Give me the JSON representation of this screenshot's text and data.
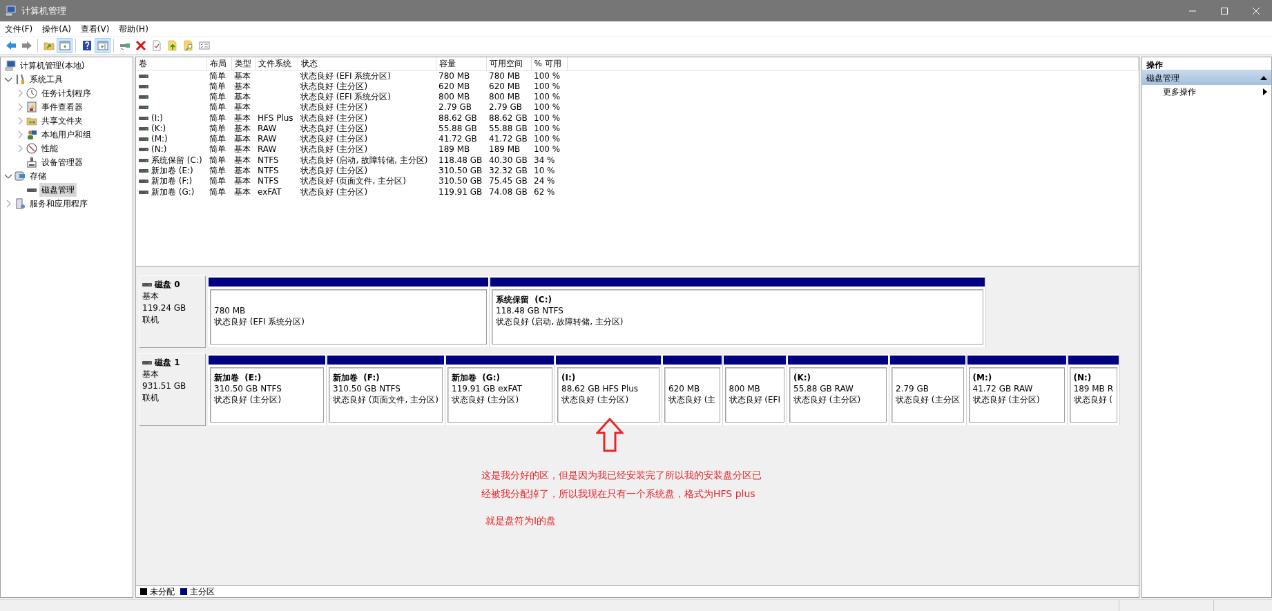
{
  "window": {
    "title": "计算机管理"
  },
  "menu": [
    {
      "label": "文件(F)"
    },
    {
      "label": "操作(A)"
    },
    {
      "label": "查看(V)"
    },
    {
      "label": "帮助(H)"
    }
  ],
  "toolbar": [
    {
      "kind": "button",
      "pressed": false
    },
    {
      "kind": "button",
      "pressed": false
    },
    {
      "kind": "separator"
    },
    {
      "kind": "button",
      "pressed": false
    },
    {
      "kind": "button",
      "pressed": true
    },
    {
      "kind": "separator"
    },
    {
      "kind": "button",
      "pressed": false
    },
    {
      "kind": "button",
      "pressed": true
    },
    {
      "kind": "separator"
    },
    {
      "kind": "button",
      "pressed": false
    },
    {
      "kind": "button",
      "pressed": false
    },
    {
      "kind": "button",
      "pressed": false
    },
    {
      "kind": "button",
      "pressed": false
    },
    {
      "kind": "button",
      "pressed": false
    },
    {
      "kind": "button",
      "pressed": false
    }
  ],
  "tree": [
    {
      "label": "计算机管理(本地)",
      "selected": false,
      "children": [
        {
          "label": "系统工具",
          "expanded": true,
          "selected": false,
          "children": [
            {
              "label": "任务计划程序",
              "expanded": false,
              "selected": false
            },
            {
              "label": "事件查看器",
              "expanded": false,
              "selected": false
            },
            {
              "label": "共享文件夹",
              "expanded": false,
              "selected": false
            },
            {
              "label": "本地用户和组",
              "expanded": false,
              "selected": false
            },
            {
              "label": "性能",
              "expanded": false,
              "selected": false
            },
            {
              "label": "设备管理器",
              "selected": false
            }
          ]
        },
        {
          "label": "存储",
          "expanded": true,
          "selected": false,
          "children": [
            {
              "label": "磁盘管理",
              "selected": true
            }
          ]
        },
        {
          "label": "服务和应用程序",
          "expanded": false,
          "selected": false
        }
      ]
    }
  ],
  "volumes": {
    "columns": [
      "卷",
      "布局",
      "类型",
      "文件系统",
      "状态",
      "容量",
      "可用空间",
      "% 可用"
    ],
    "rows": [
      {
        "layout": "简单",
        "type": "基本",
        "status": "状态良好 (EFI 系统分区)",
        "capacity": "780 MB",
        "free": "780 MB",
        "percent_free": "100 %"
      },
      {
        "layout": "简单",
        "type": "基本",
        "status": "状态良好 (主分区)",
        "capacity": "620 MB",
        "free": "620 MB",
        "percent_free": "100 %"
      },
      {
        "layout": "简单",
        "type": "基本",
        "status": "状态良好 (EFI 系统分区)",
        "capacity": "800 MB",
        "free": "800 MB",
        "percent_free": "100 %"
      },
      {
        "layout": "简单",
        "type": "基本",
        "status": "状态良好 (主分区)",
        "capacity": "2.79 GB",
        "free": "2.79 GB",
        "percent_free": "100 %"
      },
      {
        "volume": "(I:)",
        "layout": "简单",
        "type": "基本",
        "file_system": "HFS Plus",
        "status": "状态良好 (主分区)",
        "capacity": "88.62 GB",
        "free": "88.62 GB",
        "percent_free": "100 %"
      },
      {
        "volume": "(K:)",
        "layout": "简单",
        "type": "基本",
        "file_system": "RAW",
        "status": "状态良好 (主分区)",
        "capacity": "55.88 GB",
        "free": "55.88 GB",
        "percent_free": "100 %"
      },
      {
        "volume": "(M:)",
        "layout": "简单",
        "type": "基本",
        "file_system": "RAW",
        "status": "状态良好 (主分区)",
        "capacity": "41.72 GB",
        "free": "41.72 GB",
        "percent_free": "100 %"
      },
      {
        "volume": "(N:)",
        "layout": "简单",
        "type": "基本",
        "file_system": "RAW",
        "status": "状态良好 (主分区)",
        "capacity": "189 MB",
        "free": "189 MB",
        "percent_free": "100 %"
      },
      {
        "volume": "系统保留 (C:)",
        "layout": "简单",
        "type": "基本",
        "file_system": "NTFS",
        "status": "状态良好 (启动, 故障转储, 主分区)",
        "capacity": "118.48 GB",
        "free": "40.30 GB",
        "percent_free": "34 %"
      },
      {
        "volume": "新加卷 (E:)",
        "layout": "简单",
        "type": "基本",
        "file_system": "NTFS",
        "status": "状态良好 (主分区)",
        "capacity": "310.50 GB",
        "free": "32.32 GB",
        "percent_free": "10 %"
      },
      {
        "volume": "新加卷 (F:)",
        "layout": "简单",
        "type": "基本",
        "file_system": "NTFS",
        "status": "状态良好 (页面文件, 主分区)",
        "capacity": "310.50 GB",
        "free": "75.45 GB",
        "percent_free": "24 %"
      },
      {
        "volume": "新加卷 (G:)",
        "layout": "简单",
        "type": "基本",
        "file_system": "exFAT",
        "status": "状态良好 (主分区)",
        "capacity": "119.91 GB",
        "free": "74.08 GB",
        "percent_free": "62 %"
      }
    ]
  },
  "disks": [
    {
      "name": "磁盘 0",
      "type": "基本",
      "size": "119.24 GB",
      "state": "联机",
      "partitions": [
        {
          "size": "780 MB",
          "status": "状态良好 (EFI 系统分区)",
          "color": "#000080"
        },
        {
          "label": "系统保留  (C:)",
          "size": "118.48 GB NTFS",
          "status": "状态良好 (启动, 故障转储, 主分区)",
          "color": "#000080"
        }
      ]
    },
    {
      "name": "磁盘 1",
      "type": "基本",
      "size": "931.51 GB",
      "state": "联机",
      "partitions": [
        {
          "label": "新加卷  (E:)",
          "size": "310.50 GB NTFS",
          "status": "状态良好 (主分区)",
          "color": "#000080"
        },
        {
          "label": "新加卷  (F:)",
          "size": "310.50 GB NTFS",
          "status": "状态良好 (页面文件, 主分区)",
          "color": "#000080"
        },
        {
          "label": "新加卷  (G:)",
          "size": "119.91 GB exFAT",
          "status": "状态良好 (主分区)",
          "color": "#000080"
        },
        {
          "label": "(I:)",
          "size": "88.62 GB HFS Plus",
          "status": "状态良好 (主分区)",
          "color": "#000080"
        },
        {
          "size": "620 MB",
          "status": "状态良好 (主",
          "color": "#000080"
        },
        {
          "size": "800 MB",
          "status": "状态良好 (EFI",
          "color": "#000080"
        },
        {
          "label": "(K:)",
          "size": "55.88 GB RAW",
          "status": "状态良好 (主分区)",
          "color": "#000080"
        },
        {
          "size": "2.79 GB",
          "status": "状态良好 (主分区",
          "color": "#000080"
        },
        {
          "label": "(M:)",
          "size": "41.72 GB RAW",
          "status": "状态良好 (主分区)",
          "color": "#000080"
        },
        {
          "label": "(N:)",
          "size": "189 MB R",
          "status": "状态良好 (",
          "color": "#000080"
        }
      ]
    }
  ],
  "annotation": {
    "lines": [
      "这是我分好的区，但是因为我已经安装完了所以我的安装盘分区已",
      "经被我分配掉了，所以我现在只有一个系统盘，格式为HFS plus",
      "就是盘符为I的盘"
    ]
  },
  "legend": [
    {
      "label": "未分配",
      "color": "#000000"
    },
    {
      "label": "主分区",
      "color": "#000080"
    }
  ],
  "actions": {
    "title": "操作",
    "sections": [
      {
        "label": "磁盘管理",
        "expanded": true,
        "items": [
          {
            "label": "更多操作"
          }
        ]
      }
    ]
  }
}
